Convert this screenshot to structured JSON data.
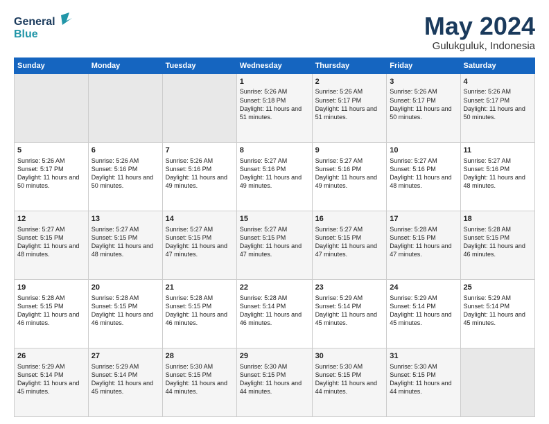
{
  "header": {
    "logo_general": "General",
    "logo_blue": "Blue",
    "month": "May 2024",
    "location": "Gulukguluk, Indonesia"
  },
  "weekdays": [
    "Sunday",
    "Monday",
    "Tuesday",
    "Wednesday",
    "Thursday",
    "Friday",
    "Saturday"
  ],
  "weeks": [
    [
      {
        "day": "",
        "sunrise": "",
        "sunset": "",
        "daylight": "",
        "empty": true
      },
      {
        "day": "",
        "sunrise": "",
        "sunset": "",
        "daylight": "",
        "empty": true
      },
      {
        "day": "",
        "sunrise": "",
        "sunset": "",
        "daylight": "",
        "empty": true
      },
      {
        "day": "1",
        "sunrise": "Sunrise: 5:26 AM",
        "sunset": "Sunset: 5:18 PM",
        "daylight": "Daylight: 11 hours and 51 minutes."
      },
      {
        "day": "2",
        "sunrise": "Sunrise: 5:26 AM",
        "sunset": "Sunset: 5:17 PM",
        "daylight": "Daylight: 11 hours and 51 minutes."
      },
      {
        "day": "3",
        "sunrise": "Sunrise: 5:26 AM",
        "sunset": "Sunset: 5:17 PM",
        "daylight": "Daylight: 11 hours and 50 minutes."
      },
      {
        "day": "4",
        "sunrise": "Sunrise: 5:26 AM",
        "sunset": "Sunset: 5:17 PM",
        "daylight": "Daylight: 11 hours and 50 minutes."
      }
    ],
    [
      {
        "day": "5",
        "sunrise": "Sunrise: 5:26 AM",
        "sunset": "Sunset: 5:17 PM",
        "daylight": "Daylight: 11 hours and 50 minutes."
      },
      {
        "day": "6",
        "sunrise": "Sunrise: 5:26 AM",
        "sunset": "Sunset: 5:16 PM",
        "daylight": "Daylight: 11 hours and 50 minutes."
      },
      {
        "day": "7",
        "sunrise": "Sunrise: 5:26 AM",
        "sunset": "Sunset: 5:16 PM",
        "daylight": "Daylight: 11 hours and 49 minutes."
      },
      {
        "day": "8",
        "sunrise": "Sunrise: 5:27 AM",
        "sunset": "Sunset: 5:16 PM",
        "daylight": "Daylight: 11 hours and 49 minutes."
      },
      {
        "day": "9",
        "sunrise": "Sunrise: 5:27 AM",
        "sunset": "Sunset: 5:16 PM",
        "daylight": "Daylight: 11 hours and 49 minutes."
      },
      {
        "day": "10",
        "sunrise": "Sunrise: 5:27 AM",
        "sunset": "Sunset: 5:16 PM",
        "daylight": "Daylight: 11 hours and 48 minutes."
      },
      {
        "day": "11",
        "sunrise": "Sunrise: 5:27 AM",
        "sunset": "Sunset: 5:16 PM",
        "daylight": "Daylight: 11 hours and 48 minutes."
      }
    ],
    [
      {
        "day": "12",
        "sunrise": "Sunrise: 5:27 AM",
        "sunset": "Sunset: 5:15 PM",
        "daylight": "Daylight: 11 hours and 48 minutes."
      },
      {
        "day": "13",
        "sunrise": "Sunrise: 5:27 AM",
        "sunset": "Sunset: 5:15 PM",
        "daylight": "Daylight: 11 hours and 48 minutes."
      },
      {
        "day": "14",
        "sunrise": "Sunrise: 5:27 AM",
        "sunset": "Sunset: 5:15 PM",
        "daylight": "Daylight: 11 hours and 47 minutes."
      },
      {
        "day": "15",
        "sunrise": "Sunrise: 5:27 AM",
        "sunset": "Sunset: 5:15 PM",
        "daylight": "Daylight: 11 hours and 47 minutes."
      },
      {
        "day": "16",
        "sunrise": "Sunrise: 5:27 AM",
        "sunset": "Sunset: 5:15 PM",
        "daylight": "Daylight: 11 hours and 47 minutes."
      },
      {
        "day": "17",
        "sunrise": "Sunrise: 5:28 AM",
        "sunset": "Sunset: 5:15 PM",
        "daylight": "Daylight: 11 hours and 47 minutes."
      },
      {
        "day": "18",
        "sunrise": "Sunrise: 5:28 AM",
        "sunset": "Sunset: 5:15 PM",
        "daylight": "Daylight: 11 hours and 46 minutes."
      }
    ],
    [
      {
        "day": "19",
        "sunrise": "Sunrise: 5:28 AM",
        "sunset": "Sunset: 5:15 PM",
        "daylight": "Daylight: 11 hours and 46 minutes."
      },
      {
        "day": "20",
        "sunrise": "Sunrise: 5:28 AM",
        "sunset": "Sunset: 5:15 PM",
        "daylight": "Daylight: 11 hours and 46 minutes."
      },
      {
        "day": "21",
        "sunrise": "Sunrise: 5:28 AM",
        "sunset": "Sunset: 5:15 PM",
        "daylight": "Daylight: 11 hours and 46 minutes."
      },
      {
        "day": "22",
        "sunrise": "Sunrise: 5:28 AM",
        "sunset": "Sunset: 5:14 PM",
        "daylight": "Daylight: 11 hours and 46 minutes."
      },
      {
        "day": "23",
        "sunrise": "Sunrise: 5:29 AM",
        "sunset": "Sunset: 5:14 PM",
        "daylight": "Daylight: 11 hours and 45 minutes."
      },
      {
        "day": "24",
        "sunrise": "Sunrise: 5:29 AM",
        "sunset": "Sunset: 5:14 PM",
        "daylight": "Daylight: 11 hours and 45 minutes."
      },
      {
        "day": "25",
        "sunrise": "Sunrise: 5:29 AM",
        "sunset": "Sunset: 5:14 PM",
        "daylight": "Daylight: 11 hours and 45 minutes."
      }
    ],
    [
      {
        "day": "26",
        "sunrise": "Sunrise: 5:29 AM",
        "sunset": "Sunset: 5:14 PM",
        "daylight": "Daylight: 11 hours and 45 minutes."
      },
      {
        "day": "27",
        "sunrise": "Sunrise: 5:29 AM",
        "sunset": "Sunset: 5:14 PM",
        "daylight": "Daylight: 11 hours and 45 minutes."
      },
      {
        "day": "28",
        "sunrise": "Sunrise: 5:30 AM",
        "sunset": "Sunset: 5:15 PM",
        "daylight": "Daylight: 11 hours and 44 minutes."
      },
      {
        "day": "29",
        "sunrise": "Sunrise: 5:30 AM",
        "sunset": "Sunset: 5:15 PM",
        "daylight": "Daylight: 11 hours and 44 minutes."
      },
      {
        "day": "30",
        "sunrise": "Sunrise: 5:30 AM",
        "sunset": "Sunset: 5:15 PM",
        "daylight": "Daylight: 11 hours and 44 minutes."
      },
      {
        "day": "31",
        "sunrise": "Sunrise: 5:30 AM",
        "sunset": "Sunset: 5:15 PM",
        "daylight": "Daylight: 11 hours and 44 minutes."
      },
      {
        "day": "",
        "sunrise": "",
        "sunset": "",
        "daylight": "",
        "empty": true
      }
    ]
  ]
}
